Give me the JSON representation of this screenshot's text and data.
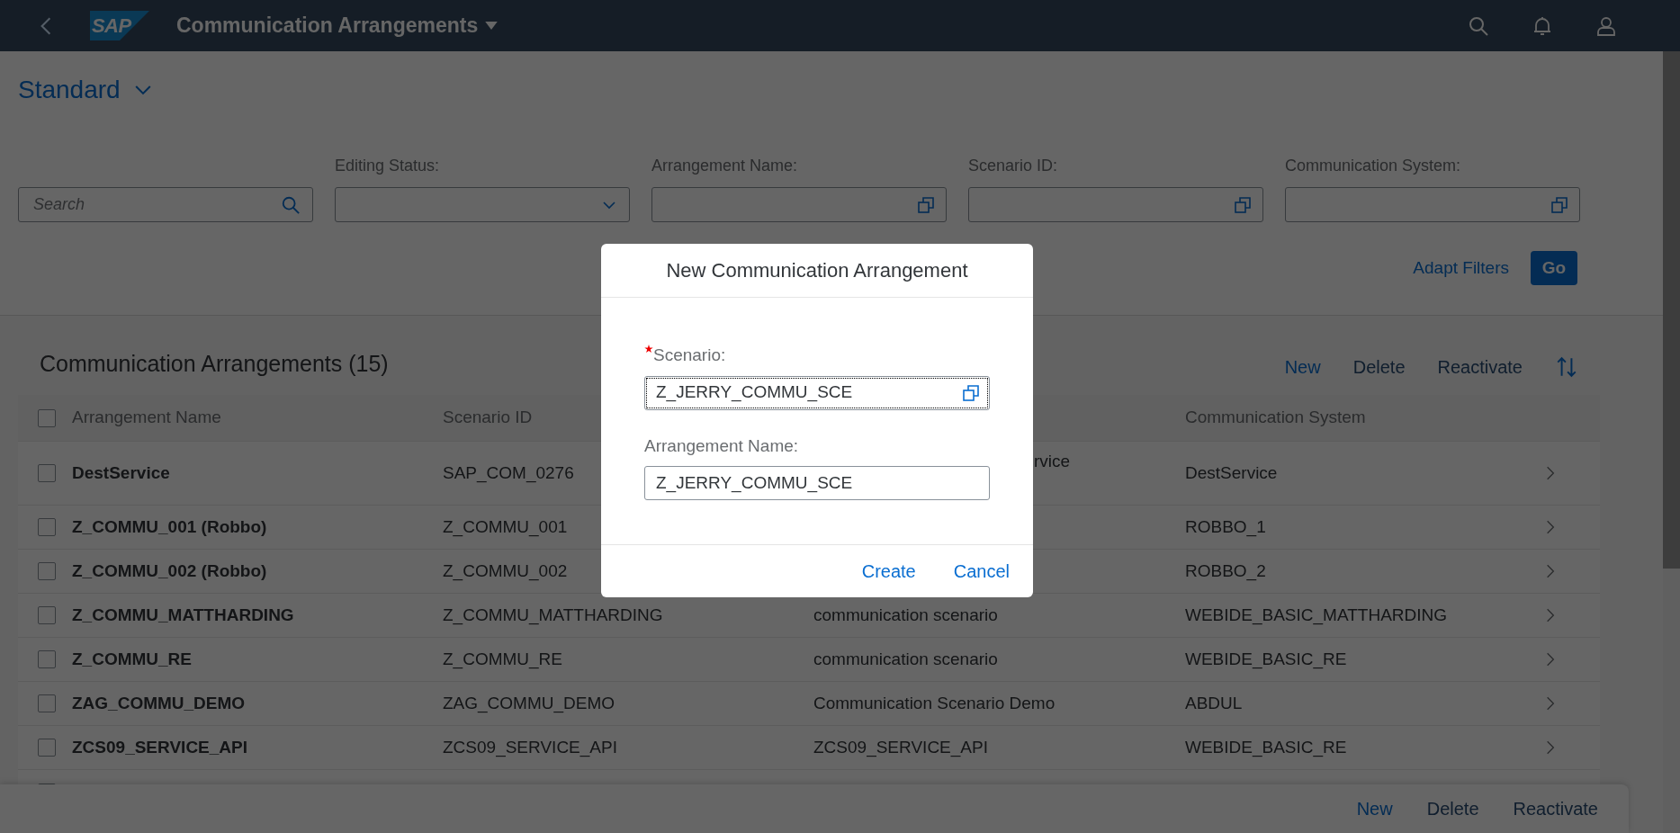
{
  "shell": {
    "logo": "SAP",
    "title": "Communication Arrangements"
  },
  "variant": {
    "label": "Standard"
  },
  "filter_bar": {
    "search": {
      "placeholder": "Search"
    },
    "filters": [
      {
        "label": "Editing Status:",
        "kind": "dropdown"
      },
      {
        "label": "Arrangement Name:",
        "kind": "value_help"
      },
      {
        "label": "Scenario ID:",
        "kind": "value_help"
      },
      {
        "label": "Communication System:",
        "kind": "value_help"
      }
    ],
    "adapt_filters": "Adapt Filters",
    "go": "Go"
  },
  "table": {
    "title": "Communication Arrangements (15)",
    "toolbar": [
      {
        "label": "New",
        "disabled": false
      },
      {
        "label": "Delete",
        "disabled": true
      },
      {
        "label": "Reactivate",
        "disabled": true
      }
    ],
    "select_all": false,
    "columns": {
      "arrangement_name": "Arrangement Name",
      "scenario_id": "Scenario ID",
      "communication_system": "Communication System"
    },
    "rows": [
      {
        "selected": false,
        "arrangement_name": "DestService",
        "scenario_id": "SAP_COM_0276",
        "column_3": "rvice",
        "communication_system": "DestService"
      },
      {
        "selected": false,
        "arrangement_name": "Z_COMMU_001 (Robbo)",
        "scenario_id": "Z_COMMU_001",
        "communication_system": "ROBBO_1"
      },
      {
        "selected": false,
        "arrangement_name": "Z_COMMU_002 (Robbo)",
        "scenario_id": "Z_COMMU_002",
        "communication_system": "ROBBO_2"
      },
      {
        "selected": false,
        "arrangement_name": "Z_COMMU_MATTHARDING",
        "scenario_id": "Z_COMMU_MATTHARDING",
        "column_3": "communication scenario",
        "communication_system": "WEBIDE_BASIC_MATTHARDING"
      },
      {
        "selected": false,
        "arrangement_name": "Z_COMMU_RE",
        "scenario_id": "Z_COMMU_RE",
        "column_3": "communication scenario",
        "communication_system": "WEBIDE_BASIC_RE"
      },
      {
        "selected": false,
        "arrangement_name": "ZAG_COMMU_DEMO",
        "scenario_id": "ZAG_COMMU_DEMO",
        "column_3": "Communication Scenario Demo",
        "communication_system": "ABDUL"
      },
      {
        "selected": false,
        "arrangement_name": "ZCS09_SERVICE_API",
        "scenario_id": "ZCS09_SERVICE_API",
        "column_3": "ZCS09_SERVICE_API",
        "communication_system": "WEBIDE_BASIC_RE"
      }
    ]
  },
  "footer_toolbar": [
    {
      "label": "New",
      "disabled": false
    },
    {
      "label": "Delete",
      "disabled": true
    },
    {
      "label": "Reactivate",
      "disabled": true
    }
  ],
  "dialog": {
    "title": "New Communication Arrangement",
    "fields": [
      {
        "label": "Scenario:",
        "required": true,
        "value": "Z_JERRY_COMMU_SCE",
        "kind": "value_help",
        "focused": true
      },
      {
        "label": "Arrangement Name:",
        "required": false,
        "value": "Z_JERRY_COMMU_SCE",
        "kind": "text",
        "focused": false
      }
    ],
    "buttons": [
      "Create",
      "Cancel"
    ]
  }
}
